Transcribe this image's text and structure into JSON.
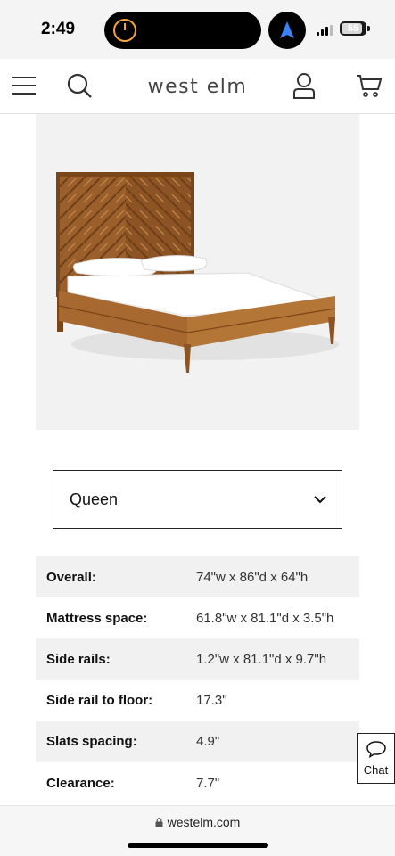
{
  "status_bar": {
    "time": "2:49",
    "battery": "55"
  },
  "header": {
    "logo": "west elm",
    "icons": [
      "menu-icon",
      "search-icon",
      "account-icon",
      "cart-icon"
    ]
  },
  "product": {
    "image": "wooden-platform-bed-chevron-headboard"
  },
  "size_select": {
    "selected": "Queen"
  },
  "specs": [
    {
      "label": "Overall:",
      "value": "74\"w x 86\"d x 64\"h"
    },
    {
      "label": "Mattress space:",
      "value": "61.8\"w x 81.1\"d x 3.5\"h"
    },
    {
      "label": "Side rails:",
      "value": "1.2\"w x 81.1\"d x 9.7\"h"
    },
    {
      "label": "Side rail to floor:",
      "value": "17.3\""
    },
    {
      "label": "Slats spacing:",
      "value": "4.9\""
    },
    {
      "label": "Clearance:",
      "value": "7.7\""
    }
  ],
  "chat": {
    "label": "Chat"
  },
  "browser": {
    "url": "westelm.com"
  },
  "colors": {
    "wood": "#9a5f2a",
    "shade_row": "#f1f1f1",
    "image_bg": "#f2f2f2"
  }
}
